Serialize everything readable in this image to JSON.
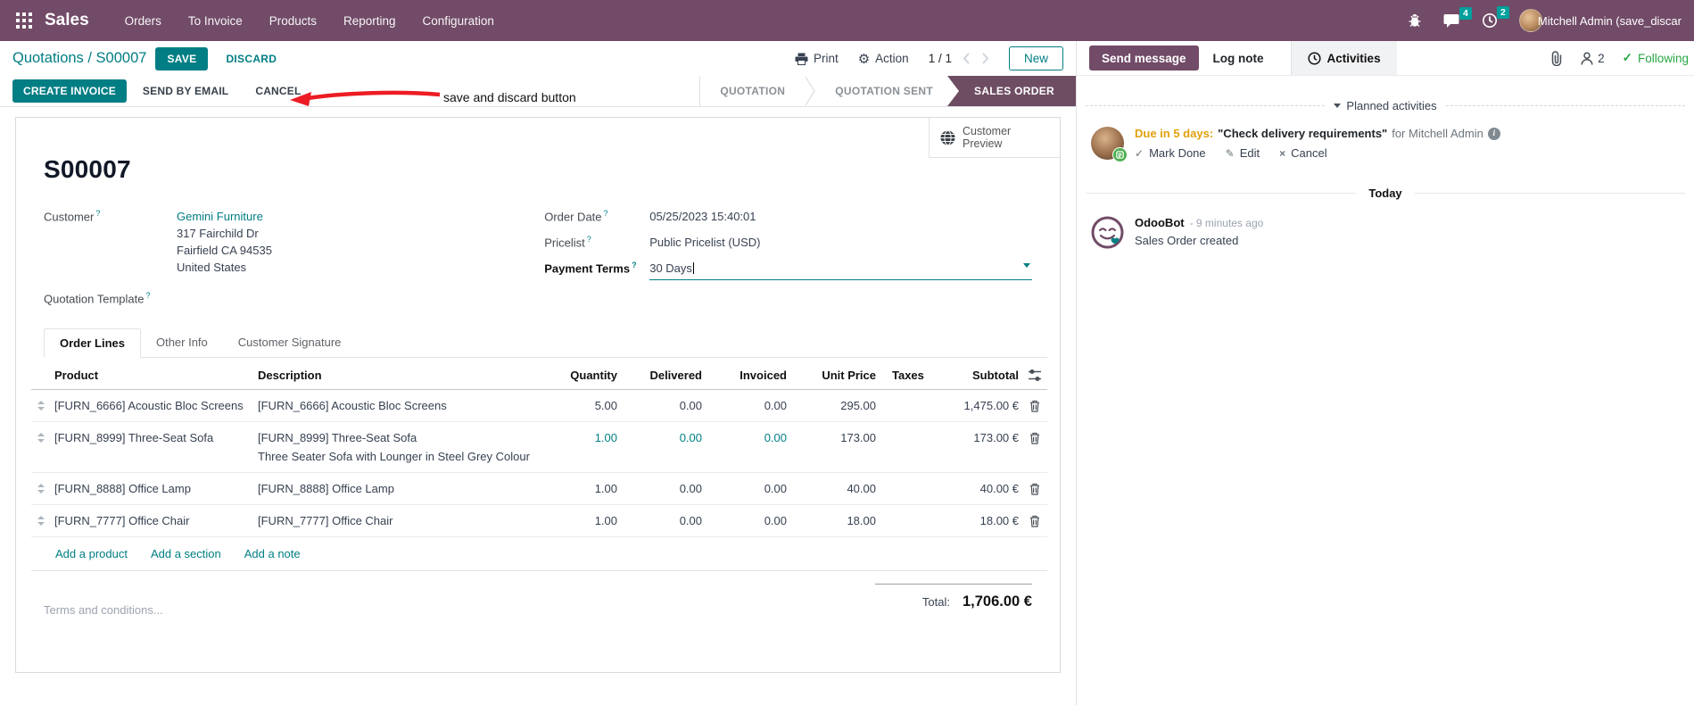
{
  "topbar": {
    "app_name": "Sales",
    "menus": [
      "Orders",
      "To Invoice",
      "Products",
      "Reporting",
      "Configuration"
    ],
    "message_badge": "4",
    "activity_badge": "2",
    "user_name": "Mitchell Admin (save_discar"
  },
  "control_panel": {
    "breadcrumb": "Quotations / S00007",
    "save_label": "SAVE",
    "discard_label": "DISCARD",
    "print_label": "Print",
    "action_label": "Action",
    "pager": "1 / 1",
    "new_label": "New"
  },
  "annotation": {
    "text": "save and discard button"
  },
  "action_buttons": {
    "create_invoice": "CREATE INVOICE",
    "send_by_email": "SEND BY EMAIL",
    "cancel": "CANCEL"
  },
  "statusbar": {
    "steps": [
      "QUOTATION",
      "QUOTATION SENT",
      "SALES ORDER"
    ],
    "active": "SALES ORDER"
  },
  "sheet": {
    "customer_preview": "Customer Preview",
    "title": "S00007",
    "help_marker": "?",
    "fields": {
      "customer_label": "Customer",
      "customer_name": "Gemini Furniture",
      "address_line1": "317 Fairchild Dr",
      "address_line2": "Fairfield CA 94535",
      "address_line3": "United States",
      "quotation_template_label": "Quotation Template",
      "order_date_label": "Order Date",
      "order_date": "05/25/2023 15:40:01",
      "pricelist_label": "Pricelist",
      "pricelist": "Public Pricelist (USD)",
      "payment_terms_label": "Payment Terms",
      "payment_terms": "30 Days"
    },
    "tabs": [
      "Order Lines",
      "Other Info",
      "Customer Signature"
    ],
    "order_lines": {
      "columns": {
        "product": "Product",
        "description": "Description",
        "quantity": "Quantity",
        "delivered": "Delivered",
        "invoiced": "Invoiced",
        "unit_price": "Unit Price",
        "taxes": "Taxes",
        "subtotal": "Subtotal"
      },
      "rows": [
        {
          "product": "[FURN_6666] Acoustic Bloc Screens",
          "description": "[FURN_6666] Acoustic Bloc Screens",
          "description2": "",
          "quantity": "5.00",
          "delivered": "0.00",
          "invoiced": "0.00",
          "unit_price": "295.00",
          "taxes": "",
          "subtotal": "1,475.00 €"
        },
        {
          "product": "[FURN_8999] Three-Seat Sofa",
          "description": "[FURN_8999] Three-Seat Sofa",
          "description2": "Three Seater Sofa with Lounger in Steel Grey Colour",
          "quantity": "1.00",
          "delivered": "0.00",
          "invoiced": "0.00",
          "unit_price": "173.00",
          "taxes": "",
          "subtotal": "173.00 €"
        },
        {
          "product": "[FURN_8888] Office Lamp",
          "description": "[FURN_8888] Office Lamp",
          "description2": "",
          "quantity": "1.00",
          "delivered": "0.00",
          "invoiced": "0.00",
          "unit_price": "40.00",
          "taxes": "",
          "subtotal": "40.00 €"
        },
        {
          "product": "[FURN_7777] Office Chair",
          "description": "[FURN_7777] Office Chair",
          "description2": "",
          "quantity": "1.00",
          "delivered": "0.00",
          "invoiced": "0.00",
          "unit_price": "18.00",
          "taxes": "",
          "subtotal": "18.00 €"
        }
      ],
      "add_links": [
        "Add a product",
        "Add a section",
        "Add a note"
      ]
    },
    "terms_placeholder": "Terms and conditions...",
    "total_label": "Total:",
    "total_value": "1,706.00 €"
  },
  "chatter": {
    "send_message": "Send message",
    "log_note": "Log note",
    "activities": "Activities",
    "followers_count": "2",
    "following": "Following",
    "planned_header": "Planned activities",
    "activity": {
      "due": "Due in 5 days:",
      "summary": "\"Check delivery requirements\"",
      "for_user": "for Mitchell Admin",
      "mark_done": "Mark Done",
      "edit": "Edit",
      "cancel": "Cancel"
    },
    "today": "Today",
    "message": {
      "author": "OdooBot",
      "time": "- 9 minutes ago",
      "body": "Sales Order created"
    }
  },
  "colors": {
    "topbar": "#714B67",
    "primary": "#017e84",
    "status_active": "#6e4d62",
    "badge": "#00a09d",
    "following": "#28a745",
    "due": "#e0a10c",
    "arrow": "#ed1c24"
  }
}
